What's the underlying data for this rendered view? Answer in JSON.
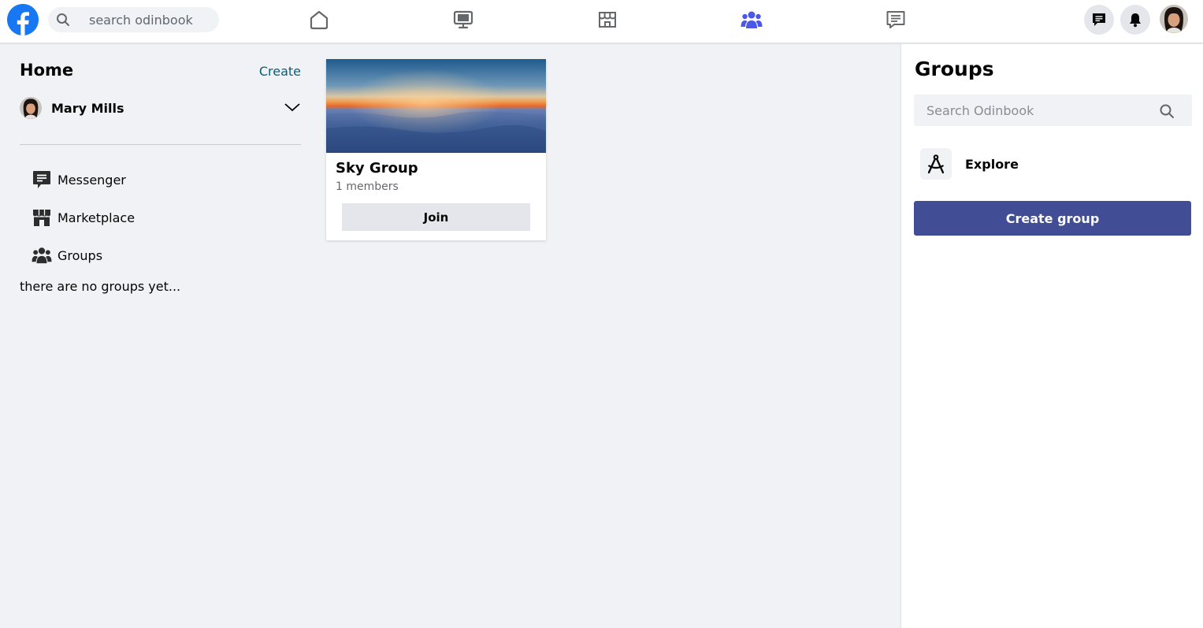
{
  "header": {
    "logo_icon": "facebook-logo-icon",
    "search_placeholder": "search odinbook",
    "nav": [
      {
        "icon": "home-icon",
        "active": false
      },
      {
        "icon": "watch-monitor-icon",
        "active": false
      },
      {
        "icon": "marketplace-store-icon",
        "active": false
      },
      {
        "icon": "groups-icon",
        "active": true
      },
      {
        "icon": "feed-message-icon",
        "active": false
      }
    ],
    "actions": [
      "messenger-icon",
      "bell-icon",
      "avatar"
    ]
  },
  "left": {
    "title": "Home",
    "create_label": "Create",
    "user_name": "Mary Mills",
    "menu": [
      {
        "icon": "messenger-icon",
        "label": "Messenger"
      },
      {
        "icon": "marketplace-icon",
        "label": "Marketplace"
      },
      {
        "icon": "groups-icon",
        "label": "Groups"
      }
    ],
    "empty_text": "there are no groups yet..."
  },
  "card": {
    "title": "Sky Group",
    "members": "1 members",
    "join_label": "Join"
  },
  "right": {
    "title": "Groups",
    "search_placeholder": "Search Odinbook",
    "explore_label": "Explore",
    "create_group_label": "Create group"
  },
  "colors": {
    "accent_blue": "#1877f2",
    "active_nav": "#4b57e6",
    "create_group_bg": "#414d94",
    "page_bg": "#f0f2f5"
  }
}
